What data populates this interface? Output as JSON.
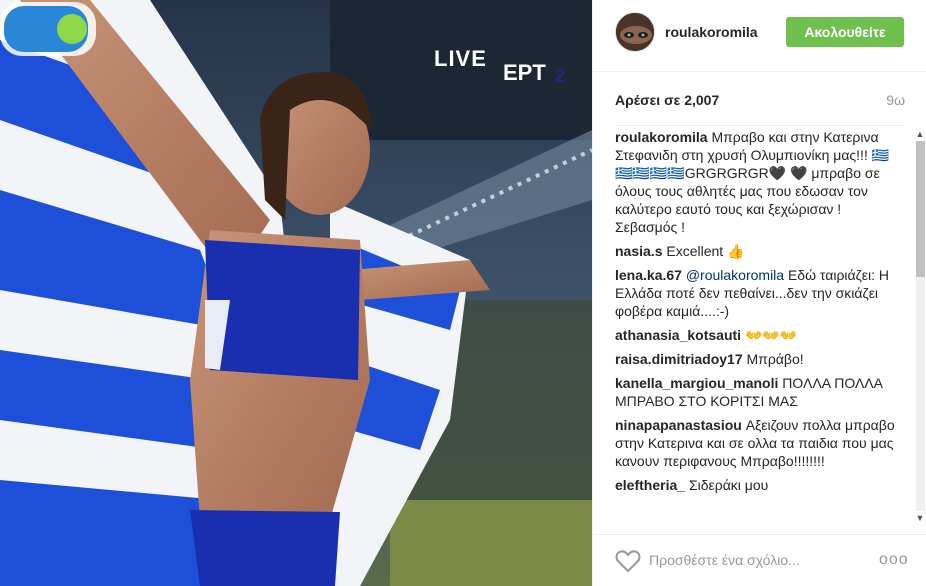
{
  "photo": {
    "live_text": "LIVE",
    "channel_label": "ΕΡΤ",
    "channel_number": "2"
  },
  "header": {
    "username": "roulakoromila",
    "follow_label": "Ακολουθείτε"
  },
  "stats": {
    "likes": "Αρέσει σε 2,007",
    "time": "9ω"
  },
  "comments": [
    {
      "user": "roulakoromila",
      "text": "Μπραβο και στην Κατερινα Στεφανιδη στη χρυσή Ολυμπιονίκη μας!!! 🇬🇷🇬🇷🇬🇷🇬🇷🇬🇷GRGRGRGR🖤 🖤 μπραβο σε όλους τους αθλητές μας που εδωσαν τον καλύτερο εαυτό τους και ξεχώρισαν ! Σεβασμός !"
    },
    {
      "user": "nasia.s",
      "text": "Excellent 👍"
    },
    {
      "user": "lena.ka.67",
      "mention": "@roulakoromila",
      "text": "Εδώ ταιριάζει: Η Ελλάδα ποτέ δεν πεθαίνει...δεν την σκιάζει φοβέρα καμιά....:-)"
    },
    {
      "user": "athanasia_kotsauti",
      "text": "👐👐👐"
    },
    {
      "user": "raisa.dimitriadoy17",
      "text": "Μπράβο!"
    },
    {
      "user": "kanella_margiou_manoli",
      "text": "ΠΟΛΛΑ ΠΟΛΛΑ ΜΠΡΑΒΟ ΣΤΟ ΚΟΡΙΤΣΙ ΜΑΣ"
    },
    {
      "user": "ninapapanastasiou",
      "text": "Αξειζουν πολλα μπραβο στην Κατερινα και σε ολλα τα παιδια που μας κανουν περιφανους Μπραβο!!!!!!!!"
    },
    {
      "user": "eleftheria_",
      "text": "Σιδεράκι μου"
    }
  ],
  "footer": {
    "comment_placeholder": "Προσθέστε ένα σχόλιο...",
    "more_label": "ooo"
  },
  "icons": {
    "heart": "heart-icon",
    "more": "more-options-icon",
    "scroll_up": "scroll-up-arrow-icon",
    "scroll_down": "scroll-down-arrow-icon"
  },
  "colors": {
    "follow_button": "#70c050",
    "greek_blue": "#1d4fd8",
    "uniform_blue": "#1a2fb0"
  }
}
